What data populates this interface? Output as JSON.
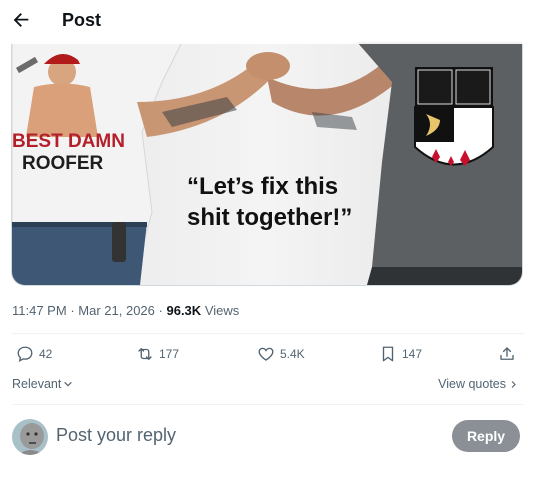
{
  "header": {
    "title": "Post",
    "back_icon": "arrow-left-icon"
  },
  "media": {
    "shirt_left_line1": "BEST DAMN",
    "shirt_left_line2": "ROOFER",
    "quote_line1": "“Let’s fix this",
    "quote_line2": "shit together!”"
  },
  "meta": {
    "time": "11:47 PM",
    "date": "Mar 21, 2026",
    "views_count": "96.3K",
    "views_label": "Views",
    "sep": "·"
  },
  "actions": {
    "replies": "42",
    "reposts": "177",
    "likes": "5.4K",
    "bookmarks": "147"
  },
  "sort": {
    "label": "Relevant"
  },
  "quotes": {
    "label": "View quotes"
  },
  "reply": {
    "placeholder": "Post your reply",
    "button": "Reply"
  },
  "colors": {
    "reply_button": "#8b9096",
    "muted_text": "#536471",
    "shirt_text": "#b3202a"
  }
}
